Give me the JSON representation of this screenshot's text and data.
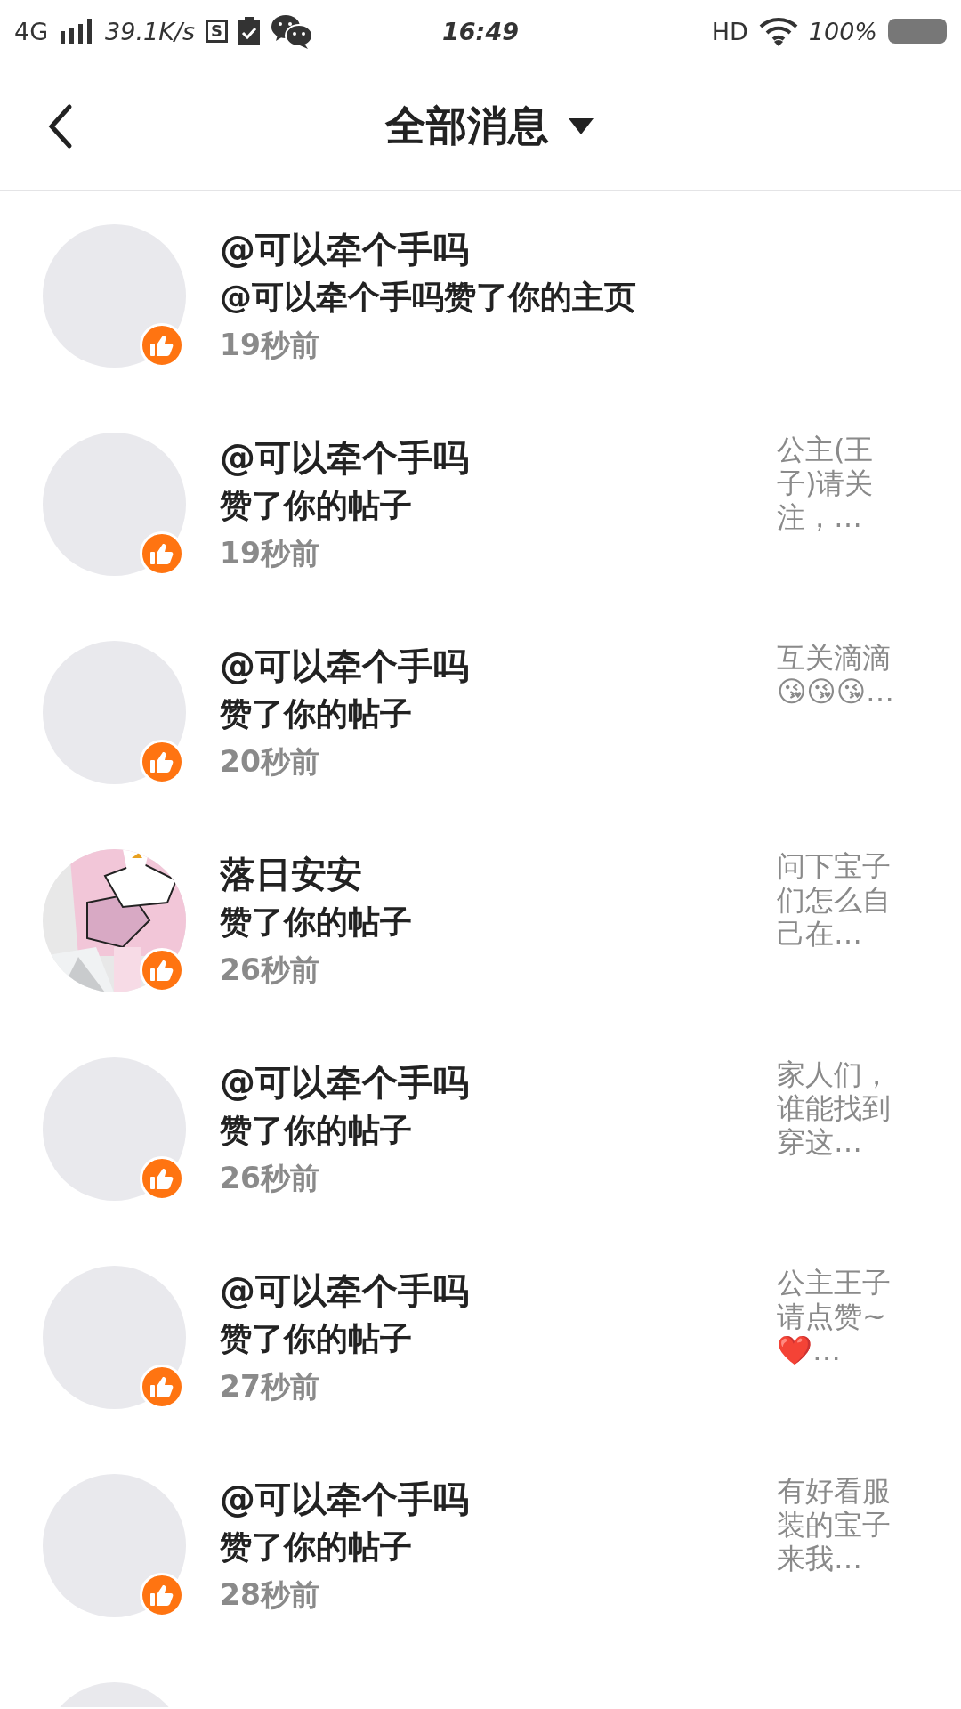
{
  "status_bar": {
    "network": "4G",
    "speed": "39.1K/s",
    "sim_badge": "S",
    "time": "16:49",
    "hd": "HD",
    "battery": "100%"
  },
  "header": {
    "title": "全部消息"
  },
  "messages": [
    {
      "name": "@可以牵个手吗",
      "action": "@可以牵个手吗赞了你的主页",
      "time": "19秒前",
      "avatar": {
        "kind": "blank"
      }
    },
    {
      "name": "@可以牵个手吗",
      "action": "赞了你的帖子",
      "time": "19秒前",
      "snippet": "公主(王子)请关注，…",
      "avatar": {
        "kind": "blank"
      }
    },
    {
      "name": "@可以牵个手吗",
      "action": "赞了你的帖子",
      "time": "20秒前",
      "snippet": "互关滴滴😘😘😘…",
      "avatar": {
        "kind": "blank"
      }
    },
    {
      "name": "落日安安",
      "action": "赞了你的帖子",
      "time": "26秒前",
      "snippet": "问下宝子们怎么自己在…"
    },
    {
      "name": "@可以牵个手吗",
      "action": "赞了你的帖子",
      "time": "26秒前",
      "snippet": "家人们，谁能找到穿这…",
      "avatar": {
        "kind": "blank"
      }
    },
    {
      "name": "@可以牵个手吗",
      "action": "赞了你的帖子",
      "time": "27秒前",
      "snippet": "公主王子请点赞~❤️…",
      "avatar": {
        "kind": "blank"
      }
    },
    {
      "name": "@可以牵个手吗",
      "action": "赞了你的帖子",
      "time": "28秒前",
      "snippet": "有好看服装的宝子来我…",
      "avatar": {
        "kind": "blank"
      }
    },
    {
      "avatar": {
        "kind": "blank"
      }
    }
  ]
}
